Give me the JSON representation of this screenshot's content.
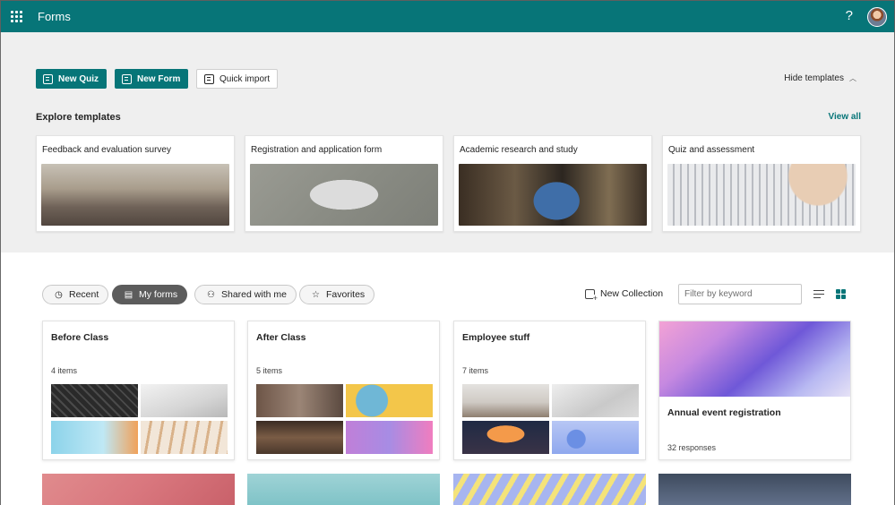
{
  "header": {
    "app_title": "Forms",
    "help_label": "?"
  },
  "actions": {
    "new_quiz": "New Quiz",
    "new_form": "New Form",
    "quick_import": "Quick import",
    "hide_templates": "Hide templates",
    "explore_templates": "Explore templates",
    "view_all": "View all"
  },
  "templates": [
    {
      "title": "Feedback and evaluation survey"
    },
    {
      "title": "Registration and application form"
    },
    {
      "title": "Academic research and study"
    },
    {
      "title": "Quiz and assessment"
    }
  ],
  "filters": {
    "tabs": [
      {
        "label": "Recent",
        "icon": "clock-icon",
        "active": false
      },
      {
        "label": "My forms",
        "icon": "document-icon",
        "active": true
      },
      {
        "label": "Shared with me",
        "icon": "people-icon",
        "active": false
      },
      {
        "label": "Favorites",
        "icon": "star-icon",
        "active": false
      }
    ],
    "new_collection": "New Collection",
    "search_placeholder": "Filter by keyword"
  },
  "collections": [
    {
      "name": "Before Class",
      "count": "4 items"
    },
    {
      "name": "After Class",
      "count": "5 items"
    },
    {
      "name": "Employee stuff",
      "count": "7 items"
    }
  ],
  "form_card": {
    "title": "Annual event registration",
    "responses": "32 responses"
  },
  "colors": {
    "brand": "#077578",
    "active_pill": "#5c5c5c"
  }
}
